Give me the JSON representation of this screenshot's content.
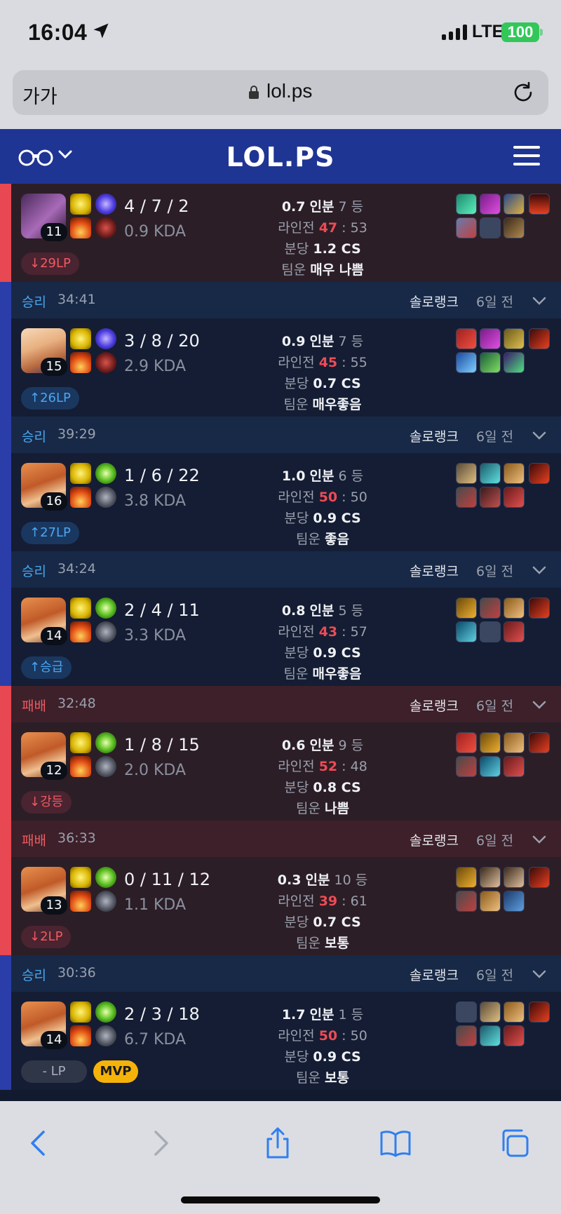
{
  "status_bar": {
    "time": "16:04",
    "network": "LTE",
    "battery": "100"
  },
  "browser": {
    "text_size": "가가",
    "url": "lol.ps"
  },
  "site": {
    "logo": "LOL.PS"
  },
  "colors": {
    "win": "#4aa6f0",
    "loss": "#ee5a62",
    "accent": "#1f3594",
    "mvp": "#f5b30a"
  },
  "labels": {
    "kill_participation": "인분",
    "rank_suffix": "등",
    "lane": "라인전",
    "cs_per_min": "분당",
    "team_luck": "팀운"
  },
  "partial_top": {
    "champion_level": "11",
    "kda": "4 / 7 / 2",
    "kda_ratio": "0.9 KDA",
    "lp": "29LP",
    "kp": "0.7",
    "rank": "7",
    "lane_self": "47",
    "lane_opp": "53",
    "cs": "1.2 CS",
    "team_luck": "매우 나쁨"
  },
  "matches": [
    {
      "result": "승리",
      "duration": "34:41",
      "queue": "솔로랭크",
      "ago": "6일 전",
      "champion_level": "15",
      "kda": "3 / 8 / 20",
      "kda_ratio": "2.9 KDA",
      "lp": "26LP",
      "kp": "0.9",
      "rank": "7",
      "lane_self": "45",
      "lane_opp": "55",
      "cs": "0.7 CS",
      "team_luck": "매우좋음"
    },
    {
      "result": "승리",
      "duration": "39:29",
      "queue": "솔로랭크",
      "ago": "6일 전",
      "champion_level": "16",
      "kda": "1 / 6 / 22",
      "kda_ratio": "3.8 KDA",
      "lp": "27LP",
      "kp": "1.0",
      "rank": "6",
      "lane_self": "50",
      "lane_opp": "50",
      "cs": "0.9 CS",
      "team_luck": "좋음"
    },
    {
      "result": "승리",
      "duration": "34:24",
      "queue": "솔로랭크",
      "ago": "6일 전",
      "champion_level": "14",
      "kda": "2 / 4 / 11",
      "kda_ratio": "3.3 KDA",
      "lp": "승급",
      "kp": "0.8",
      "rank": "5",
      "lane_self": "43",
      "lane_opp": "57",
      "cs": "0.9 CS",
      "team_luck": "매우좋음"
    },
    {
      "result": "패배",
      "duration": "32:48",
      "queue": "솔로랭크",
      "ago": "6일 전",
      "champion_level": "12",
      "kda": "1 / 8 / 15",
      "kda_ratio": "2.0 KDA",
      "lp": "강등",
      "kp": "0.6",
      "rank": "9",
      "lane_self": "52",
      "lane_opp": "48",
      "cs": "0.8 CS",
      "team_luck": "나쁨"
    },
    {
      "result": "패배",
      "duration": "36:33",
      "queue": "솔로랭크",
      "ago": "6일 전",
      "champion_level": "13",
      "kda": "0 / 11 / 12",
      "kda_ratio": "1.1 KDA",
      "lp": "2LP",
      "kp": "0.3",
      "rank": "10",
      "lane_self": "39",
      "lane_opp": "61",
      "cs": "0.7 CS",
      "team_luck": "보통"
    },
    {
      "result": "승리",
      "duration": "30:36",
      "queue": "솔로랭크",
      "ago": "6일 전",
      "champion_level": "14",
      "kda": "2 / 3 / 18",
      "kda_ratio": "6.7 KDA",
      "lp": "- LP",
      "mvp": "MVP",
      "kp": "1.7",
      "rank": "1",
      "lane_self": "50",
      "lane_opp": "50",
      "cs": "0.9 CS",
      "team_luck": "보통"
    }
  ]
}
